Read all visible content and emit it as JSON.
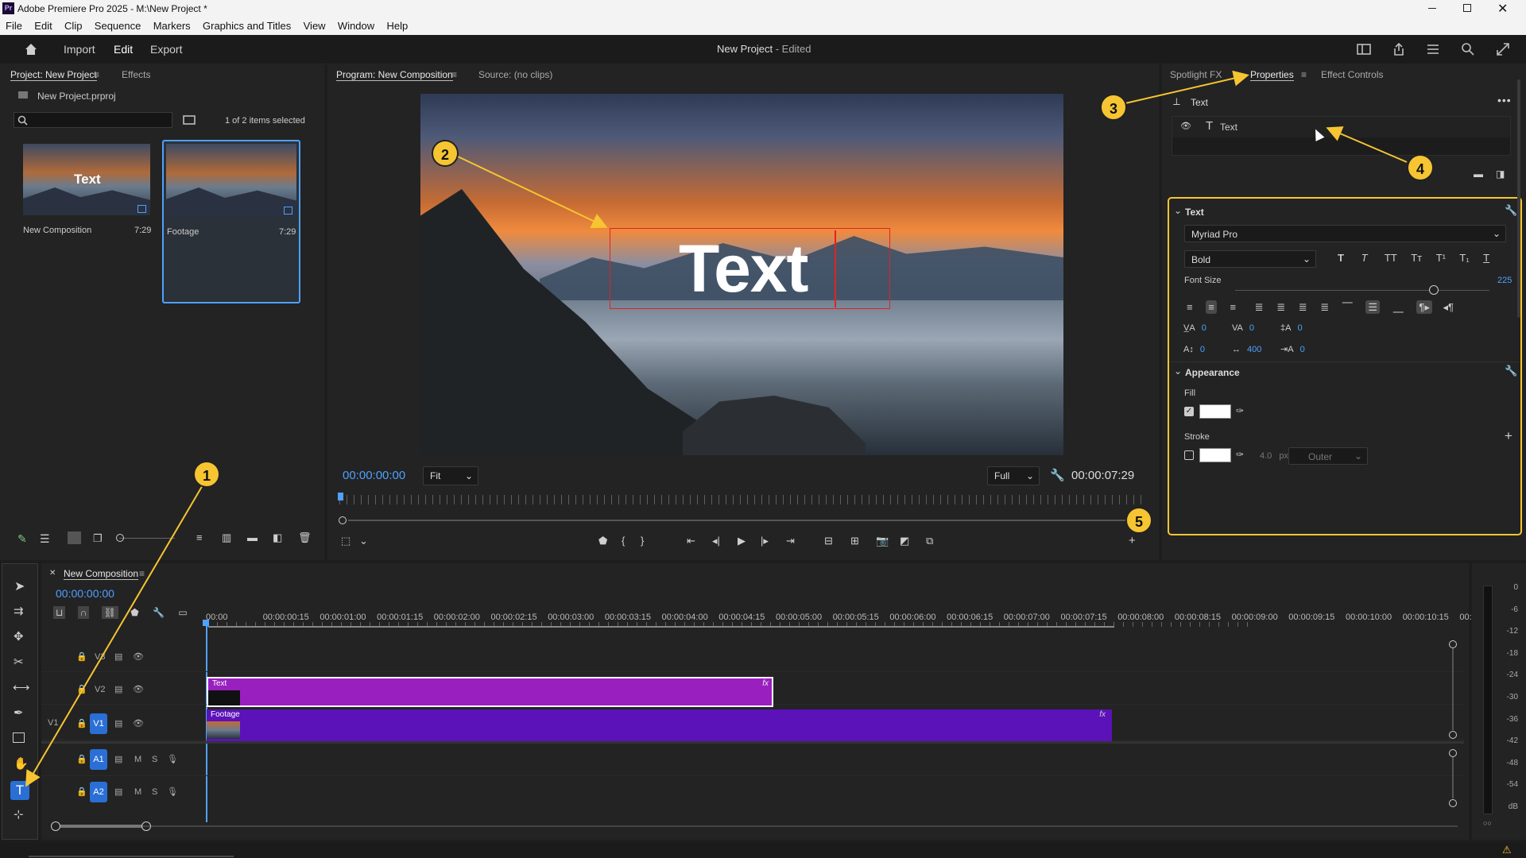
{
  "window": {
    "title": "Adobe Premiere Pro 2025 - M:\\New Project *",
    "app_badge": "Pr"
  },
  "menu": [
    "File",
    "Edit",
    "Clip",
    "Sequence",
    "Markers",
    "Graphics and Titles",
    "View",
    "Window",
    "Help"
  ],
  "header": {
    "nav": [
      "Import",
      "Edit",
      "Export"
    ],
    "active": "Edit",
    "project_title": "New Project",
    "project_status": "- Edited"
  },
  "project_panel": {
    "tabs": [
      "Project: New Project",
      "Effects"
    ],
    "file": "New Project.prproj",
    "selection_count": "1 of 2 items selected",
    "items": [
      {
        "name": "New Composition",
        "duration": "7:29",
        "thumb_text": "Text"
      },
      {
        "name": "Footage",
        "duration": "7:29"
      }
    ]
  },
  "monitor": {
    "tabs": [
      "Program: New Composition",
      "Source: (no clips)"
    ],
    "overlay_text": "Text",
    "timecode_current": "00:00:00:00",
    "fit": "Fit",
    "quality": "Full",
    "timecode_duration": "00:00:07:29"
  },
  "properties": {
    "tabs": [
      "Spotlight FX",
      "Properties",
      "Effect Controls"
    ],
    "active_tab": "Properties",
    "header": "Text",
    "layer": "Text",
    "text_section": {
      "title": "Text",
      "font": "Myriad Pro",
      "style": "Bold",
      "font_size_label": "Font Size",
      "font_size": "225",
      "font_size_fraction": 0.78,
      "tracking": [
        {
          "icon": "kerning-icon",
          "value": "0"
        },
        {
          "icon": "tracking-icon",
          "value": "0"
        },
        {
          "icon": "leading-icon",
          "value": "0"
        },
        {
          "icon": "baseline-icon",
          "value": "0"
        },
        {
          "icon": "tsume-icon",
          "value": "400"
        },
        {
          "icon": "tab-width-icon",
          "value": "0"
        }
      ]
    },
    "appearance": {
      "title": "Appearance",
      "fill_label": "Fill",
      "fill_checked": true,
      "fill_color": "#ffffff",
      "stroke_label": "Stroke",
      "stroke_checked": false,
      "stroke_color": "#ffffff",
      "stroke_width": "4.0",
      "stroke_unit": "px",
      "stroke_position": "Outer"
    }
  },
  "timeline": {
    "tab": "New Composition",
    "timecode": "00:00:00:00",
    "ruler": [
      "00:00",
      "00:00:00:15",
      "00:00:01:00",
      "00:00:01:15",
      "00:00:02:00",
      "00:00:02:15",
      "00:00:03:00",
      "00:00:03:15",
      "00:00:04:00",
      "00:00:04:15",
      "00:00:05:00",
      "00:00:05:15",
      "00:00:06:00",
      "00:00:06:15",
      "00:00:07:00",
      "00:00:07:15",
      "00:00:08:00",
      "00:00:08:15",
      "00:00:09:00",
      "00:00:09:15",
      "00:00:10:00",
      "00:00:10:15",
      "00:0"
    ],
    "tracks": {
      "v3": "V3",
      "v2": "V2",
      "v1": "V1",
      "v1_source": "V1",
      "a1": "A1",
      "a2": "A2",
      "m": "M",
      "s": "S"
    },
    "clips": [
      {
        "name": "Text",
        "fx": "fx"
      },
      {
        "name": "Footage",
        "fx": "fx"
      }
    ]
  },
  "meter": [
    "0",
    "-6",
    "-12",
    "-18",
    "-24",
    "-30",
    "-36",
    "-42",
    "-48",
    "-54",
    "dB"
  ],
  "callouts": [
    "1",
    "2",
    "3",
    "4",
    "5"
  ],
  "colors": {
    "accent": "#4ea1ff",
    "callout": "#f6c531",
    "clip_text": "#9a1fbf",
    "clip_footage": "#5b12b8"
  }
}
